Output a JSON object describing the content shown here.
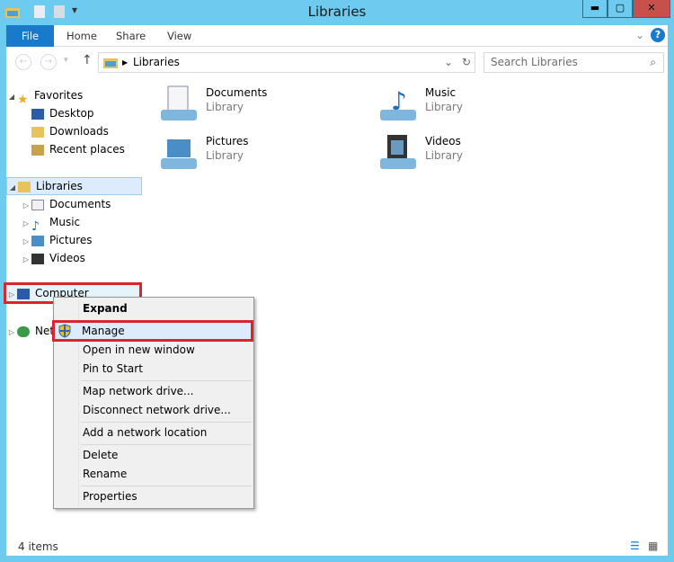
{
  "window": {
    "title": "Libraries",
    "controls": [
      "minimize",
      "maximize",
      "close"
    ]
  },
  "ribbon": {
    "tabs": [
      "File",
      "Home",
      "Share",
      "View"
    ]
  },
  "address": {
    "path": "Libraries",
    "search_placeholder": "Search Libraries"
  },
  "nav": {
    "favorites": {
      "label": "Favorites",
      "items": [
        "Desktop",
        "Downloads",
        "Recent places"
      ]
    },
    "libraries": {
      "label": "Libraries",
      "items": [
        "Documents",
        "Music",
        "Pictures",
        "Videos"
      ]
    },
    "computer": "Computer",
    "network": "Network"
  },
  "content": {
    "items": [
      {
        "name": "Documents",
        "type": "Library"
      },
      {
        "name": "Music",
        "type": "Library"
      },
      {
        "name": "Pictures",
        "type": "Library"
      },
      {
        "name": "Videos",
        "type": "Library"
      }
    ]
  },
  "menu": {
    "items": [
      "Expand",
      "Manage",
      "Open in new window",
      "Pin to Start",
      "Map network drive...",
      "Disconnect network drive...",
      "Add a network location",
      "Delete",
      "Rename",
      "Properties"
    ]
  },
  "status": {
    "count": "4 items"
  },
  "colors": {
    "highlight": "#d8252e",
    "accent": "#1979ca"
  }
}
